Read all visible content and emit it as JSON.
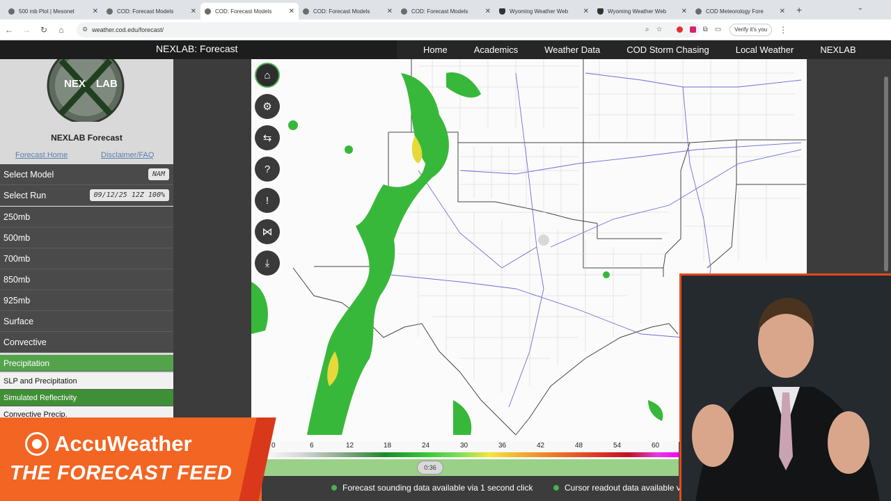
{
  "browser": {
    "tabs": [
      {
        "title": "500 mb Plot | Mesonet",
        "active": false
      },
      {
        "title": "COD: Forecast Models",
        "active": false
      },
      {
        "title": "COD: Forecast Models",
        "active": true
      },
      {
        "title": "COD: Forecast Models",
        "active": false
      },
      {
        "title": "COD: Forecast Models",
        "active": false
      },
      {
        "title": "Wyoming Weather Web",
        "active": false
      },
      {
        "title": "Wyoming Weather Web",
        "active": false
      },
      {
        "title": "COD Meteorology   Fore",
        "active": false
      }
    ],
    "url": "weather.cod.edu/forecast/",
    "verify_label": "Verify it's you"
  },
  "site": {
    "brand": "NEXLAB: Forecast",
    "nav": [
      "Home",
      "Academics",
      "Weather Data",
      "COD Storm Chasing",
      "Local Weather",
      "NEXLAB"
    ]
  },
  "sidebar": {
    "logo_text": "NEX LAB",
    "title": "NEXLAB Forecast",
    "links": [
      "Forecast Home",
      "Disclaimer/FAQ"
    ],
    "select_model_label": "Select Model",
    "select_model_value": "NAM",
    "select_run_label": "Select Run",
    "select_run_value": "09/12/25 12Z 100%",
    "levels": [
      "250mb",
      "500mb",
      "700mb",
      "850mb",
      "925mb",
      "Surface",
      "Convective"
    ],
    "selected_category": "Precipitation",
    "products": [
      "SLP and Precipitation",
      "Simulated Reflectivity",
      "Convective Precip."
    ]
  },
  "colorbar": {
    "ticks": [
      "0",
      "6",
      "12",
      "18",
      "24",
      "30",
      "36",
      "42",
      "48",
      "54",
      "60"
    ],
    "knob_label": "0:36"
  },
  "status": {
    "sounding": "Forecast sounding data available via 1 second click",
    "cursor": "Cursor readout data available v"
  },
  "banner": {
    "brand": "AccuWeather",
    "show": "THE FORECAST FEED"
  },
  "colors": {
    "accent_green": "#54a34b",
    "banner_orange": "#f26522"
  }
}
